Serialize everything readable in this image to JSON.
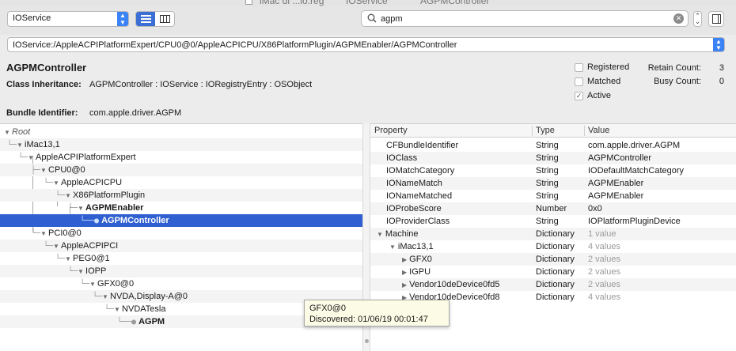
{
  "window": {
    "title_left": "iMac di ...lo.reg",
    "title_mid": "IOService",
    "title_right": "AGPMController"
  },
  "toolbar": {
    "plane_select": "IOService",
    "search_value": "agpm"
  },
  "path": "IOService:/AppleACPIPlatformExpert/CPU0@0/AppleACPICPU/X86PlatformPlugin/AGPMEnabler/AGPMController",
  "info": {
    "class_name": "AGPMController",
    "inheritance_label": "Class Inheritance:",
    "inheritance_value": "AGPMController : IOService : IORegistryEntry : OSObject",
    "bundle_label": "Bundle Identifier:",
    "bundle_value": "com.apple.driver.AGPM",
    "checks": [
      {
        "label": "Registered",
        "checked": false
      },
      {
        "label": "Matched",
        "checked": false
      },
      {
        "label": "Active",
        "checked": true
      }
    ],
    "retain_label": "Retain Count:",
    "retain_value": "3",
    "busy_label": "Busy Count:",
    "busy_value": "0"
  },
  "tree": [
    {
      "label": "Root",
      "style": "ital",
      "expanded": true
    },
    {
      "label": "iMac13,1",
      "expanded": true
    },
    {
      "label": "AppleACPIPlatformExpert",
      "expanded": true
    },
    {
      "label": "CPU0@0",
      "expanded": true
    },
    {
      "label": "AppleACPICPU",
      "expanded": true
    },
    {
      "label": "X86PlatformPlugin",
      "expanded": true
    },
    {
      "label": "AGPMEnabler",
      "style": "bold",
      "expanded": true
    },
    {
      "label": "AGPMController",
      "style": "bold",
      "selected": true
    },
    {
      "label": "PCI0@0",
      "expanded": true
    },
    {
      "label": "AppleACPIPCI",
      "expanded": true
    },
    {
      "label": "PEG0@1",
      "expanded": true
    },
    {
      "label": "IOPP",
      "expanded": true
    },
    {
      "label": "GFX0@0",
      "expanded": true
    },
    {
      "label": "NVDA,Display-A@0",
      "expanded": true
    },
    {
      "label": "NVDATesla",
      "expanded": true
    },
    {
      "label": "AGPM",
      "style": "bold"
    }
  ],
  "props": {
    "headers": {
      "property": "Property",
      "type": "Type",
      "value": "Value"
    },
    "rows": [
      {
        "key": "CFBundleIdentifier",
        "type": "String",
        "value": "com.apple.driver.AGPM"
      },
      {
        "key": "IOClass",
        "type": "String",
        "value": "AGPMController"
      },
      {
        "key": "IOMatchCategory",
        "type": "String",
        "value": "IODefaultMatchCategory"
      },
      {
        "key": "IONameMatch",
        "type": "String",
        "value": "AGPMEnabler"
      },
      {
        "key": "IONameMatched",
        "type": "String",
        "value": "AGPMEnabler"
      },
      {
        "key": "IOProbeScore",
        "type": "Number",
        "value": "0x0"
      },
      {
        "key": "IOProviderClass",
        "type": "String",
        "value": "IOPlatformPluginDevice"
      },
      {
        "key": "Machine",
        "type": "Dictionary",
        "value": "1 value",
        "dim": true,
        "tri": "▼"
      },
      {
        "key": "iMac13,1",
        "type": "Dictionary",
        "value": "4 values",
        "dim": true,
        "tri": "▼"
      },
      {
        "key": "GFX0",
        "type": "Dictionary",
        "value": "2 values",
        "dim": true,
        "tri": "▶"
      },
      {
        "key": "IGPU",
        "type": "Dictionary",
        "value": "2 values",
        "dim": true,
        "tri": "▶"
      },
      {
        "key": "Vendor10deDevice0fd5",
        "type": "Dictionary",
        "value": "2 values",
        "dim": true,
        "tri": "▶"
      },
      {
        "key": "Vendor10deDevice0fd8",
        "type": "Dictionary",
        "value": "4 values",
        "dim": true,
        "tri": "▶"
      }
    ]
  },
  "tooltip": {
    "line1": "GFX0@0",
    "line2": "Discovered: 01/06/19 00:01:47"
  },
  "icons": {
    "search": "search-icon",
    "clear": "clear-icon",
    "list_view": "list-view-icon",
    "column_view": "column-view-icon",
    "inspector": "inspector-icon"
  }
}
